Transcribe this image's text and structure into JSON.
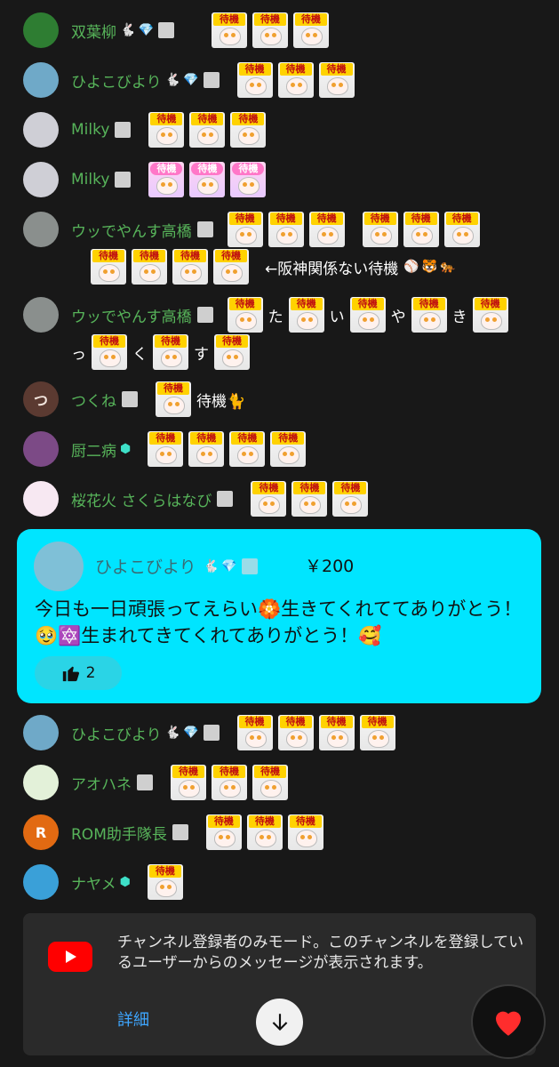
{
  "messages": [
    {
      "id": "m1",
      "author": "双葉柳",
      "badges": [
        "rabbit",
        "gem",
        "sticker"
      ],
      "avatar_color": "#2e7d32",
      "emote_count": 3,
      "emote_label": "待機",
      "line2": ""
    },
    {
      "id": "m2",
      "author": "ひよこびより",
      "badges": [
        "rabbit",
        "gem",
        "sticker"
      ],
      "avatar_color": "#6fa9c8",
      "emote_count": 3,
      "emote_label": "待機"
    },
    {
      "id": "m3",
      "author": "Milky",
      "badges": [
        "sticker"
      ],
      "avatar_color": "#cfcfd6",
      "emote_count": 3,
      "emote_label": "待機"
    },
    {
      "id": "m4",
      "author": "Milky",
      "badges": [
        "sticker"
      ],
      "avatar_color": "#cfcfd6",
      "emote_count": 3,
      "emote_label": "待機",
      "pink": true
    },
    {
      "id": "m5",
      "author": "ウッでやんす高橋",
      "badges": [
        "sticker"
      ],
      "avatar_color": "#8a8f8d",
      "emote_count": 3,
      "emote_label": "待機",
      "extra_group": 3,
      "line2_count": 4,
      "line2_text": "←阪神関係ない待機"
    },
    {
      "id": "m6",
      "author": "ウッでやんす高橋",
      "badges": [
        "sticker"
      ],
      "avatar_color": "#8a8f8d",
      "mixed_line1": [
        "待機",
        "た",
        "待機",
        "い",
        "待機",
        "や",
        "待機",
        "き",
        "待機"
      ],
      "mixed_line2": [
        "っ",
        "待機",
        "く",
        "待機",
        "す",
        "待機"
      ]
    },
    {
      "id": "m7",
      "author": "つくね",
      "badges": [
        "sticker"
      ],
      "avatar_color": "#5b3a31",
      "avatar_text": "つ",
      "emote_count": 1,
      "emote_label": "待機",
      "trailing_text": "待機🐈"
    },
    {
      "id": "m8",
      "author": "厨二病",
      "badges": [
        "member"
      ],
      "avatar_color": "#7c4a86",
      "emote_count": 4,
      "emote_label": "待機"
    },
    {
      "id": "m9",
      "author": "桜花火 さくらはなび",
      "badges": [
        "sticker"
      ],
      "avatar_color": "#f7e8f2",
      "emote_count": 3,
      "emote_label": "待機"
    }
  ],
  "superchat": {
    "author": "ひよこびより",
    "amount": "￥200",
    "message": "今日も一日頑張ってえらい🏵️生きてくれててありがとう！🥹🔯生まれてきてくれてありがとう！🥰",
    "likes": "2"
  },
  "messages_after": [
    {
      "id": "m10",
      "author": "ひよこびより",
      "badges": [
        "rabbit",
        "gem",
        "sticker"
      ],
      "avatar_color": "#6fa9c8",
      "emote_count": 4,
      "emote_label": "待機"
    },
    {
      "id": "m11",
      "author": "アオハネ",
      "badges": [
        "sticker"
      ],
      "avatar_color": "#e3f1d9",
      "emote_count": 3,
      "emote_label": "待機"
    },
    {
      "id": "m12",
      "author": "ROM助手隊長",
      "badges": [
        "sticker"
      ],
      "avatar_color": "#e26a12",
      "avatar_text": "R",
      "emote_count": 3,
      "emote_label": "待機"
    },
    {
      "id": "m13",
      "author": "ナヤメ",
      "badges": [
        "member"
      ],
      "avatar_color": "#3aa0d8",
      "emote_count": 1,
      "emote_label": "待機"
    }
  ],
  "banner": {
    "text": "チャンネル登録者のみモード。このチャンネルを登録しているユーザーからのメッセージが表示されます。",
    "link": "詳細"
  },
  "icons": {
    "youtube": "youtube-logo-icon",
    "scroll": "arrow-down-icon",
    "heart": "heart-icon",
    "like": "thumbs-up-icon"
  },
  "colors": {
    "author_green": "#57b45a",
    "superchat_bg": "#00e5ff",
    "heart": "#ff2d2d",
    "link": "#3ea6ff"
  }
}
